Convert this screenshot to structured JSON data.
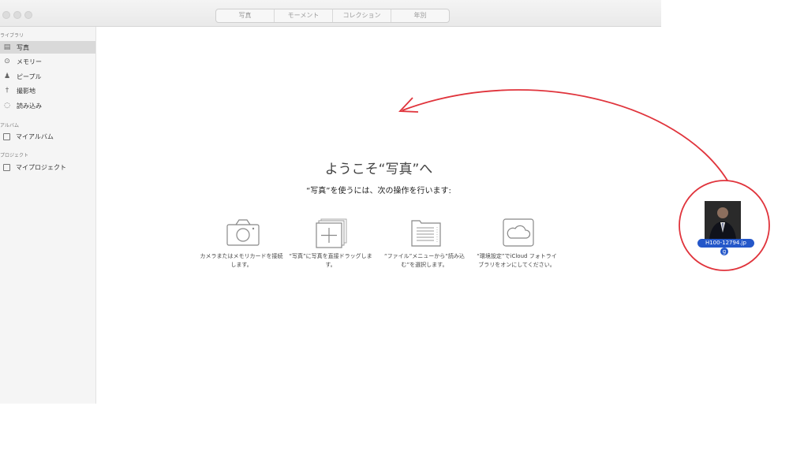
{
  "toolbar": {
    "segments": [
      "写真",
      "モーメント",
      "コレクション",
      "年別"
    ]
  },
  "sidebar": {
    "sections": [
      "ライブラリ",
      "アルバム",
      "プロジェクト"
    ],
    "library_items": [
      {
        "label": "写真",
        "icon": "photos-icon",
        "selected": true
      },
      {
        "label": "メモリー",
        "icon": "memories-icon",
        "selected": false
      },
      {
        "label": "ピープル",
        "icon": "people-icon",
        "selected": false
      },
      {
        "label": "撮影地",
        "icon": "places-icon",
        "selected": false
      },
      {
        "label": "読み込み",
        "icon": "imports-icon",
        "selected": false
      }
    ],
    "album_items": [
      {
        "label": "マイアルバム",
        "icon": "folder-icon"
      }
    ],
    "project_items": [
      {
        "label": "マイプロジェクト",
        "icon": "folder-icon"
      }
    ]
  },
  "welcome": {
    "title": "ようこそ“写真”へ",
    "subtitle": "“写真”を使うには、次の操作を行います:"
  },
  "steps": [
    {
      "icon": "camera-icon",
      "label": "カメラまたはメモリカードを接続します。"
    },
    {
      "icon": "drag-photos-icon",
      "label": "“写真”に写真を直接ドラッグします。"
    },
    {
      "icon": "file-import-icon",
      "label": "“ファイル”メニューから“読み込む”を選択します。"
    },
    {
      "icon": "icloud-icon",
      "label": "“環境設定”でiCloud フォトライブラリをオンにしてください。"
    }
  ],
  "desktop_file": {
    "name_line1": "H100-12794.jp",
    "name_line2": "g"
  },
  "colors": {
    "annotation": "#e0343c",
    "selection": "#2457c9"
  }
}
